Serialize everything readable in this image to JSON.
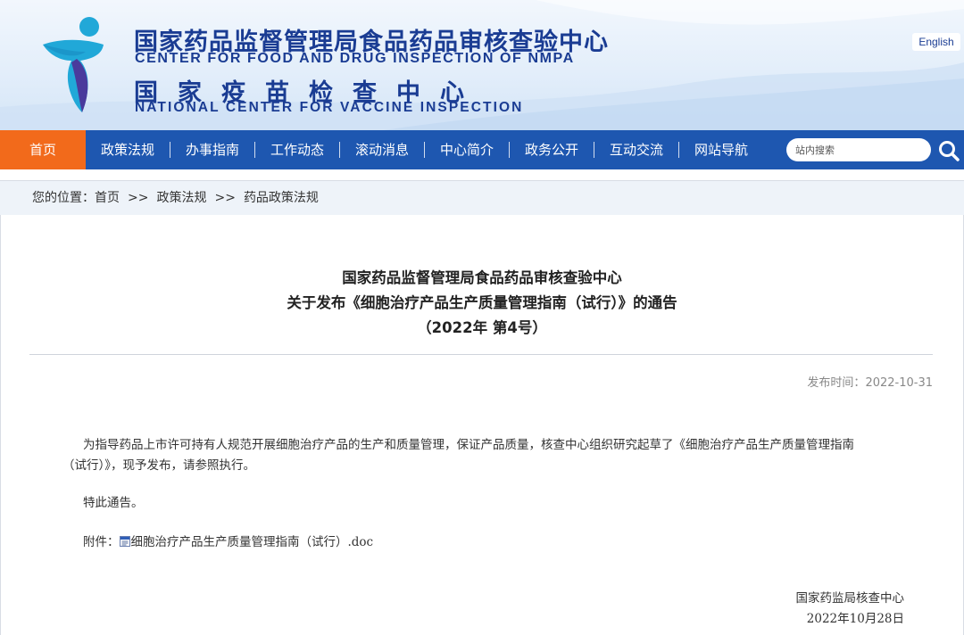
{
  "header": {
    "org_cn": "国家药品监督管理局食品药品审核查验中心",
    "org_en": "CENTER FOR FOOD AND DRUG INSPECTION OF NMPA",
    "org2_cn": "国家疫苗检查中心",
    "org2_en": "NATIONAL CENTER FOR VACCINE INSPECTION",
    "lang_button": "English",
    "colors": {
      "brand_blue": "#1a3c93",
      "nav_blue": "#1e57b0",
      "active_orange": "#f26a1b",
      "logo_cyan": "#21a8d8",
      "logo_purple": "#4a3a9c"
    }
  },
  "nav": {
    "items": [
      {
        "label": "首页",
        "active": true
      },
      {
        "label": "政策法规"
      },
      {
        "label": "办事指南"
      },
      {
        "label": "工作动态"
      },
      {
        "label": "滚动消息"
      },
      {
        "label": "中心简介"
      },
      {
        "label": "政务公开"
      },
      {
        "label": "互动交流"
      },
      {
        "label": "网站导航"
      }
    ],
    "search_placeholder": "站内搜索",
    "search_icon": "search-icon"
  },
  "breadcrumb": {
    "prefix": "您的位置：",
    "items": [
      "首页",
      "政策法规",
      "药品政策法规"
    ],
    "separator": ">>"
  },
  "article": {
    "title_lines": [
      "国家药品监督管理局食品药品审核查验中心",
      "关于发布《细胞治疗产品生产质量管理指南（试行）》的通告",
      "（2022年 第4号）"
    ],
    "publish_label": "发布时间：",
    "publish_date": "2022-10-31",
    "paragraph_line1": "为指导药品上市许可持有人规范开展细胞治疗产品的生产和质量管理，保证产品质量，核查中心组织研究起草了《细胞治疗产品生产质量管理指南",
    "paragraph_line2": "（试行）》，现予发布，请参照执行。",
    "notice": "特此通告。",
    "attachment_label": "附件：",
    "attachment_name": "细胞治疗产品生产质量管理指南（试行）.doc",
    "attachment_icon": "word-doc-icon",
    "signature_org": "国家药监局核查中心",
    "signature_date": "2022年10月28日"
  }
}
